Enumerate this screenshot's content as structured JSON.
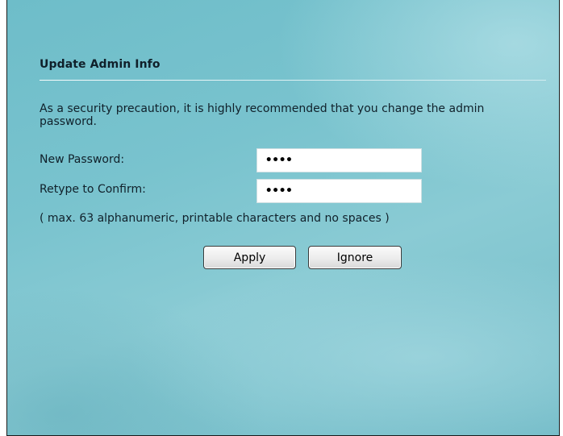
{
  "dialog": {
    "title": "Update Admin Info",
    "description": "As a security precaution, it is highly recommended that you change the admin password.",
    "fields": {
      "new_password": {
        "label": "New Password:",
        "value": "••••"
      },
      "confirm_password": {
        "label": "Retype to Confirm:",
        "value": "••••"
      }
    },
    "note": "( max. 63 alphanumeric, printable characters and no spaces )",
    "buttons": {
      "apply": "Apply",
      "ignore": "Ignore"
    }
  },
  "colors": {
    "background": "#79c3ce",
    "text": "#10202a",
    "rule": "#ffffff",
    "input_bg": "#ffffff"
  }
}
